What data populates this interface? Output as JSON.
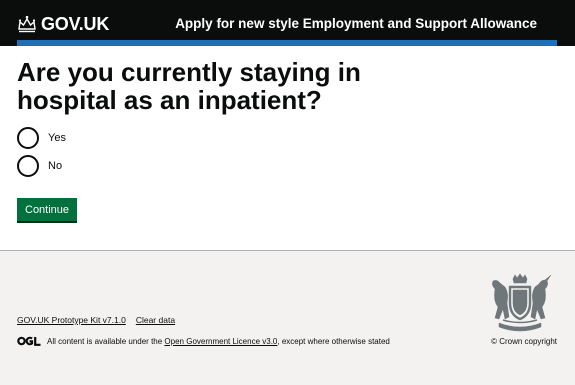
{
  "header": {
    "logo_text": "GOV.UK",
    "service_name": "Apply for new style Employment and Support Allowance"
  },
  "main": {
    "question": "Are you currently staying in hospital as an inpatient?",
    "options": [
      {
        "label": "Yes"
      },
      {
        "label": "No"
      }
    ],
    "continue_label": "Continue"
  },
  "footer": {
    "links": [
      {
        "label": "GOV.UK Prototype Kit v7.1.0"
      },
      {
        "label": "Clear data"
      }
    ],
    "licence_prefix": "All content is available under the ",
    "licence_link": "Open Government Licence v3.0",
    "licence_suffix": ", except where otherwise stated",
    "copyright": "© Crown copyright"
  },
  "colors": {
    "header_bg": "#0b0c0c",
    "header_bar": "#1d70b8",
    "button": "#00703c",
    "footer_bg": "#f3f2f1"
  }
}
